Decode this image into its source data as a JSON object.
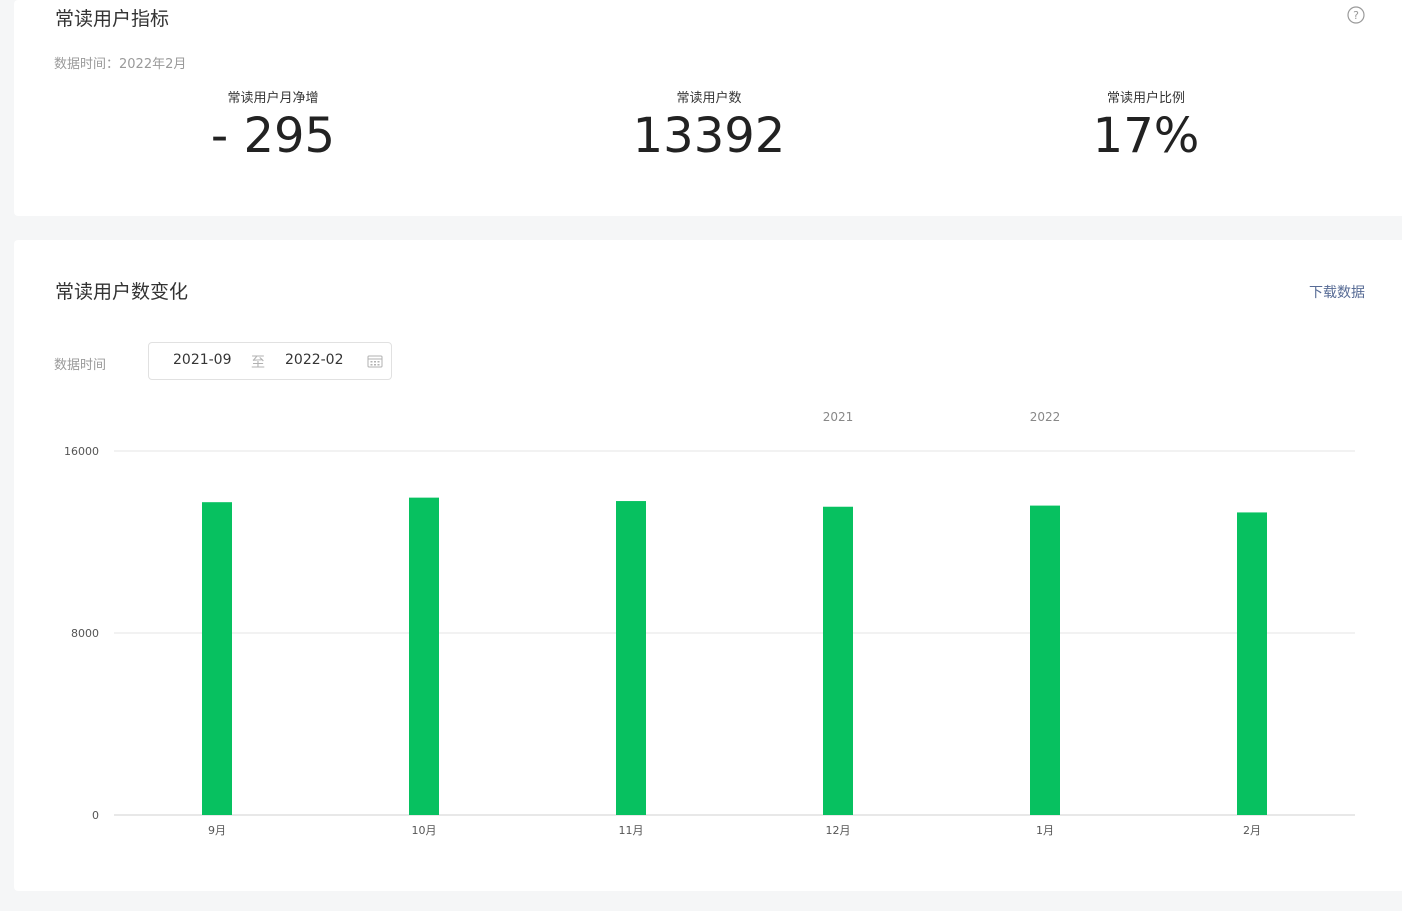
{
  "metrics_card": {
    "title": "常读用户指标",
    "data_time": "数据时间：2022年2月",
    "help_icon": "question-circle-icon",
    "items": [
      {
        "label": "常读用户月净增",
        "value": "- 295"
      },
      {
        "label": "常读用户数",
        "value": "13392"
      },
      {
        "label": "常读用户比例",
        "value": "17%"
      }
    ]
  },
  "trend_card": {
    "title": "常读用户数变化",
    "download_label": "下载数据",
    "range_label": "数据时间",
    "range_start": "2021-09",
    "range_separator": "至",
    "range_end": "2022-02",
    "calendar_icon": "calendar-icon"
  },
  "colors": {
    "bar": "#07c160",
    "link": "#576b95",
    "grid": "#e5e5e5"
  },
  "chart_data": {
    "type": "bar",
    "categories": [
      "9月",
      "10月",
      "11月",
      "12月",
      "1月",
      "2月"
    ],
    "values": [
      13750,
      13950,
      13800,
      13550,
      13600,
      13300
    ],
    "year_markers": [
      {
        "before_category": "12月",
        "label": "2021"
      },
      {
        "before_category": "1月",
        "label": "2022"
      }
    ],
    "yticks": [
      "0",
      "8000",
      "16000"
    ],
    "ylim": [
      0,
      16000
    ],
    "grid": true,
    "title": "",
    "xlabel": "",
    "ylabel": ""
  }
}
